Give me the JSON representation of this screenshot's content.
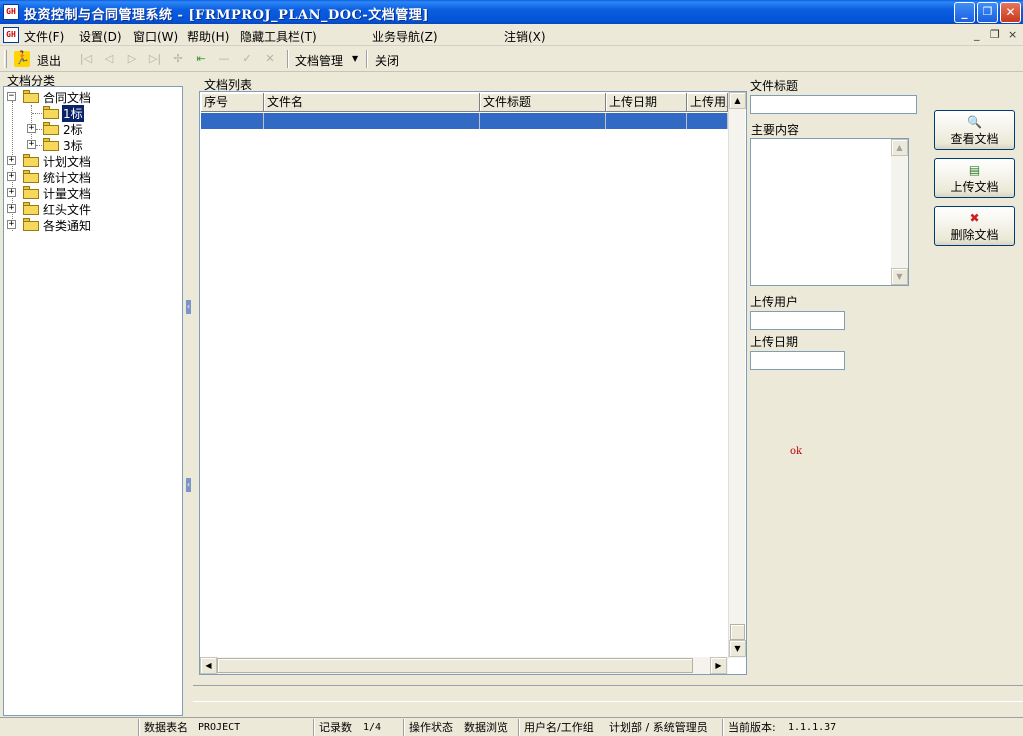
{
  "window": {
    "title": "投资控制与合同管理系统 - [FRMPROJ_PLAN_DOC-文档管理]",
    "icon_text": "GH",
    "controls": [
      "_",
      "❐",
      "✕"
    ]
  },
  "menu": {
    "items": [
      "文件(F)",
      "设置(D)",
      "窗口(W)",
      "帮助(H)",
      "隐藏工具栏(T)",
      "业务导航(Z)",
      "注销(X)"
    ],
    "mdi_controls": [
      "_",
      "❐",
      "×"
    ]
  },
  "toolbar": {
    "exit_label": "退出",
    "doc_manage_label": "文档管理",
    "close_label": "关闭",
    "nav_icons": [
      "first-icon",
      "prev-icon",
      "next-icon",
      "last-icon",
      "add-icon",
      "delete-icon",
      "cancel-icon",
      "confirm-icon",
      "discard-icon"
    ]
  },
  "tree": {
    "group_label": "文档分类",
    "nodes": [
      {
        "label": "合同文档",
        "expanded": true,
        "children": [
          {
            "label": "1标",
            "selected": true
          },
          {
            "label": "2标"
          },
          {
            "label": "3标"
          }
        ]
      },
      {
        "label": "计划文档"
      },
      {
        "label": "统计文档"
      },
      {
        "label": "计量文档"
      },
      {
        "label": "红头文件"
      },
      {
        "label": "各类通知"
      }
    ]
  },
  "doc_list": {
    "group_label": "文档列表",
    "columns": [
      "序号",
      "文件名",
      "文件标题",
      "上传日期",
      "上传用户"
    ]
  },
  "form": {
    "title_label": "文件标题",
    "title_value": "",
    "content_label": "主要内容",
    "content_value": "",
    "user_label": "上传用户",
    "user_value": "",
    "date_label": "上传日期",
    "date_value": ""
  },
  "actions": {
    "view_label": "查看文档",
    "upload_label": "上传文档",
    "delete_label": "删除文档"
  },
  "misc": {
    "ok_text": "ok"
  },
  "status": {
    "table_label": "数据表名",
    "table_value": "PROJECT",
    "records_label": "记录数",
    "records_value": "1/4",
    "state_label": "操作状态",
    "state_value": "数据浏览",
    "user_label": "用户名/工作组",
    "user_value": "计划部 / 系统管理员",
    "version_label": "当前版本:",
    "version_value": "1.1.1.37"
  },
  "colors": {
    "titlebar": "#0a5ee0",
    "selection": "#316ac5",
    "tree_selection": "#0a246a",
    "ok_text": "#c00000"
  }
}
